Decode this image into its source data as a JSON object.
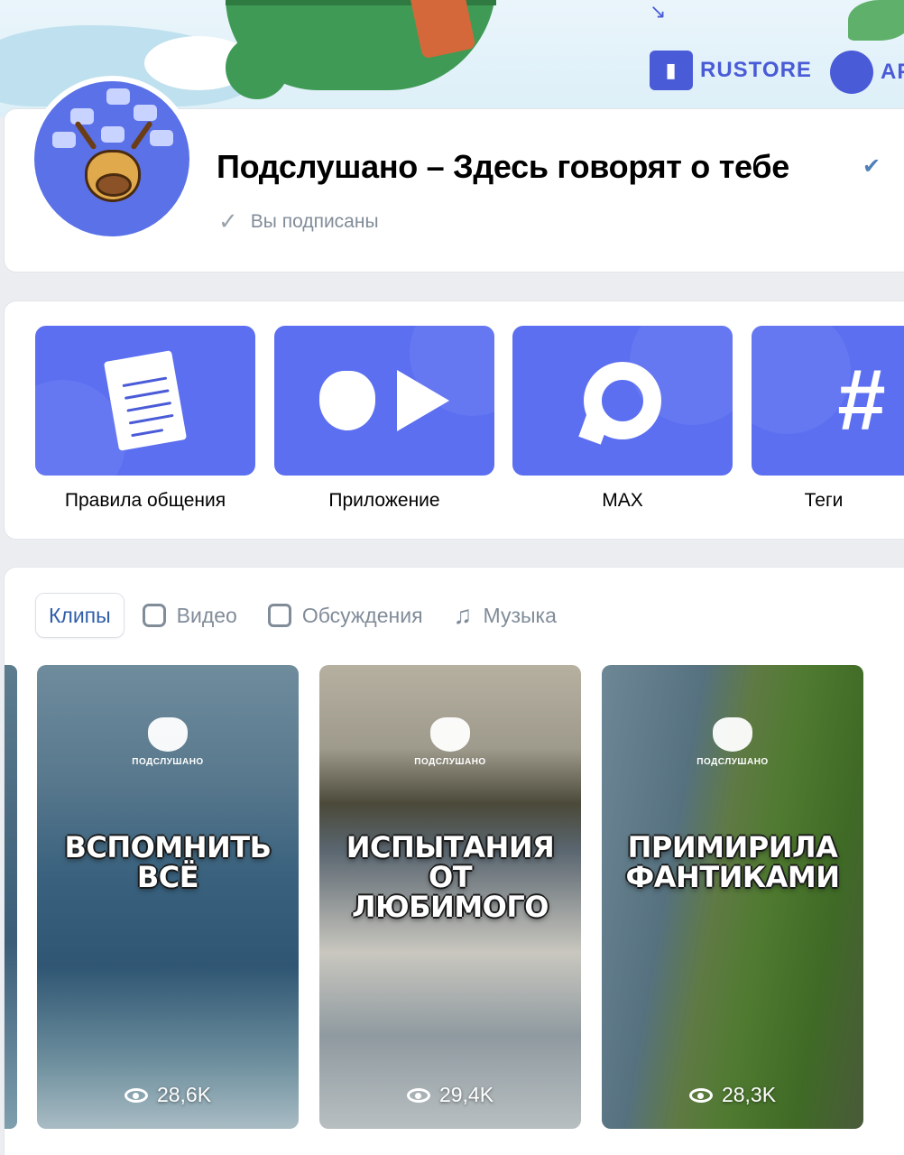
{
  "cover": {
    "stores": [
      {
        "label": "RUSTORE",
        "icon": "rustore-icon"
      },
      {
        "label": "AP",
        "icon": "apple-icon"
      }
    ]
  },
  "header": {
    "title": "Подслушано – Здесь говорят о тебе",
    "verified_icon": "verified-check-icon",
    "subscribed_text": "Вы подписаны"
  },
  "links": [
    {
      "label": "Правила общения",
      "icon": "document-icon"
    },
    {
      "label": "Приложение",
      "icon": "apple-play-icon"
    },
    {
      "label": "MAX",
      "icon": "max-messenger-icon"
    },
    {
      "label": "Теги",
      "icon": "hashtag-icon"
    }
  ],
  "tabs": [
    {
      "label": "Клипы",
      "icon": "clip-icon",
      "active": true
    },
    {
      "label": "Видео",
      "icon": "video-icon",
      "active": false
    },
    {
      "label": "Обсуждения",
      "icon": "chat-icon",
      "active": false
    },
    {
      "label": "Музыка",
      "icon": "music-icon",
      "active": false
    }
  ],
  "clips": [
    {
      "logo": "ПОДСЛУШАНО",
      "caption_line1": "вспомнить",
      "caption_line2": "всё",
      "views": "28,6K"
    },
    {
      "logo": "ПОДСЛУШАНО",
      "caption_line1": "испытания",
      "caption_line2": "от любимого",
      "views": "29,4K"
    },
    {
      "logo": "ПОДСЛУШАНО",
      "caption_line1": "примирила",
      "caption_line2": "фантиками",
      "views": "28,3K"
    }
  ],
  "colors": {
    "accent": "#5b6ff0",
    "link_blue": "#2f5fa8",
    "muted": "#818c99"
  }
}
